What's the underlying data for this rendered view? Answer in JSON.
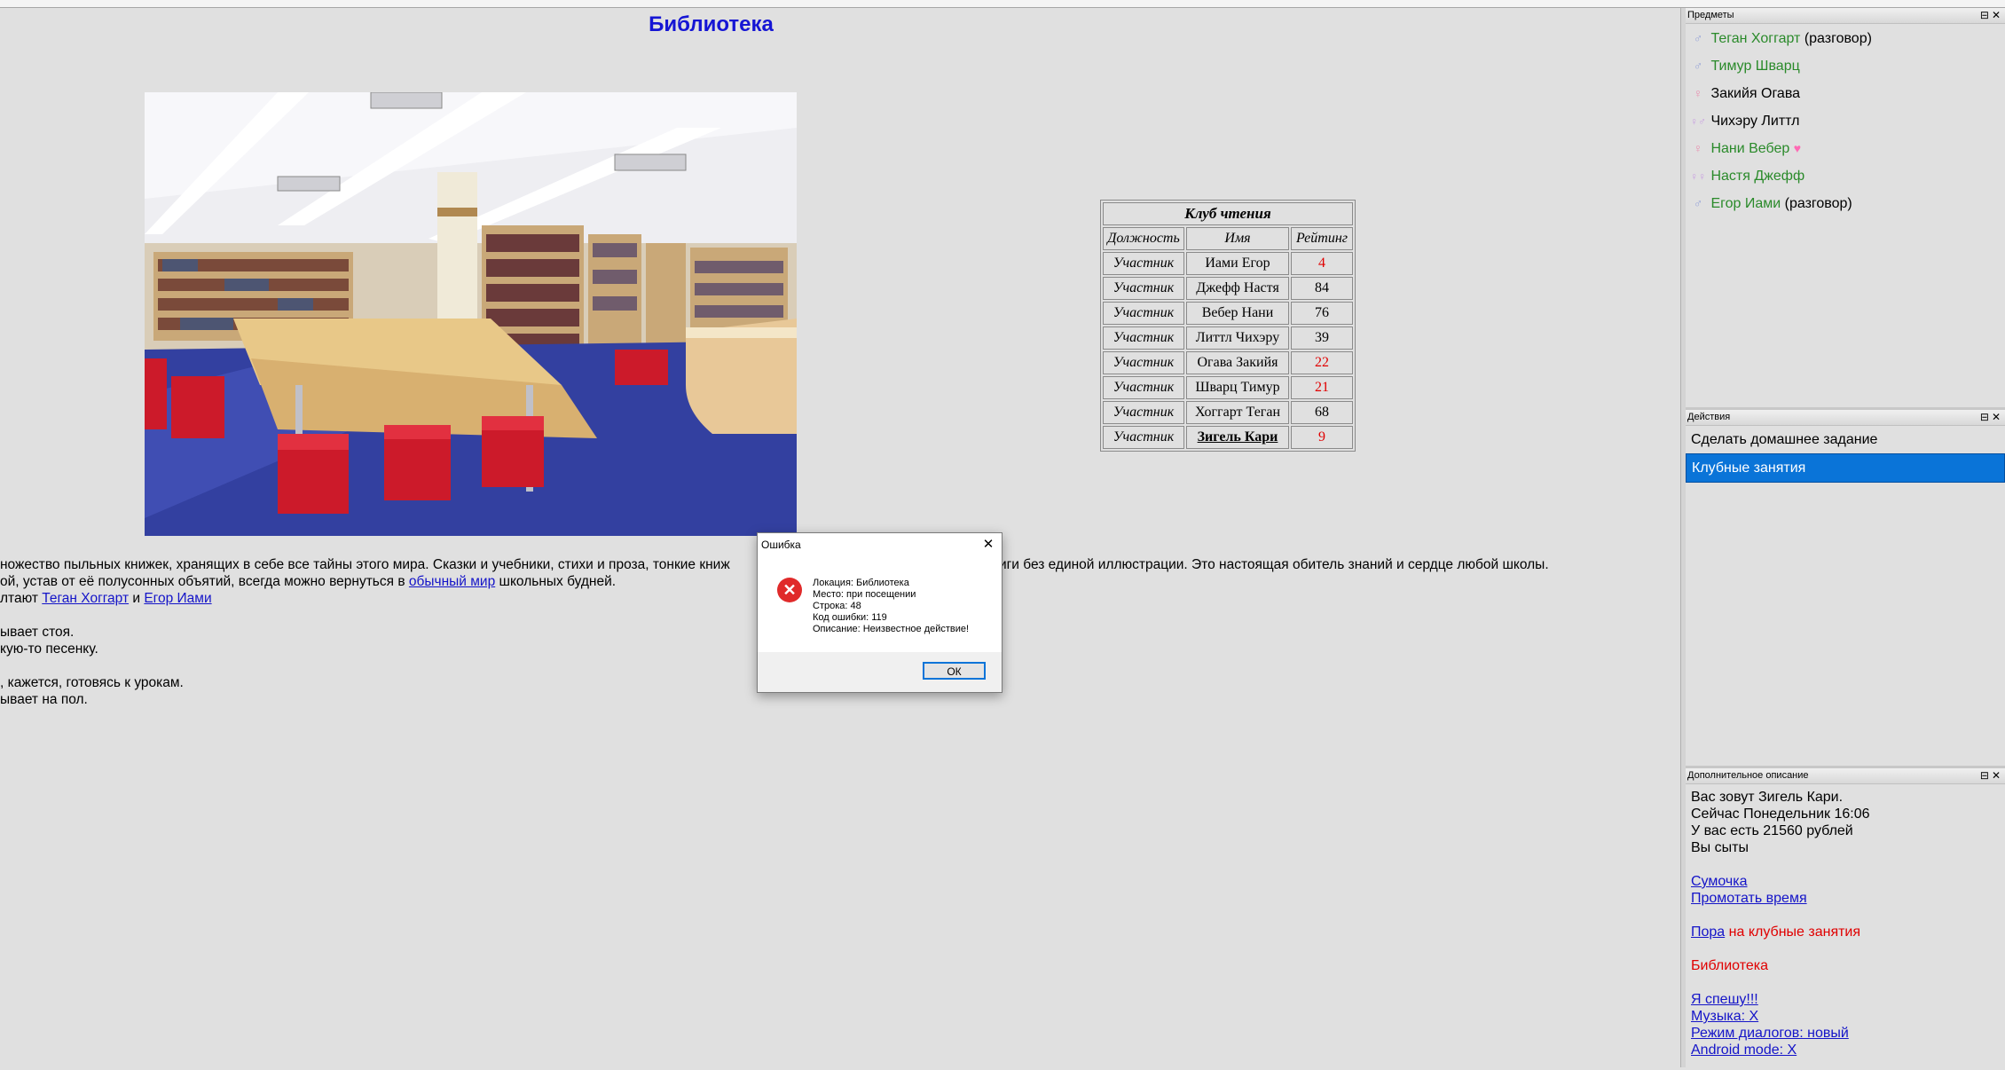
{
  "location_title": "Библиотека",
  "story": {
    "line1": "ножество пыльных книжек, хранящих в себе все тайны этого мира. Сказки и учебники, стихи и проза, тонкие книж",
    "line1_tail": "е книги без единой иллюстрации. Это настоящая обитель знаний и сердце любой школы.",
    "line2_pre": "ой, устав от её полусонных объятий, всегда можно вернуться в ",
    "line2_link": "обычный мир",
    "line2_post": " школьных будней.",
    "line3_pre": "лтают ",
    "line3_link1": "Теган Хоггарт",
    "line3_mid": " и ",
    "line3_link2": "Егор Иами",
    "line4": "ывает стоя.",
    "line5": "кую-то песенку.",
    "line6": ", кажется, готовясь к урокам.",
    "line7": "ывает на пол."
  },
  "club": {
    "caption": "Клуб чтения",
    "headers": [
      "Должность",
      "Имя",
      "Рейтинг"
    ],
    "rows": [
      {
        "role": "Участник",
        "name": "Иами Егор",
        "rating": "4"
      },
      {
        "role": "Участник",
        "name": "Джефф Настя",
        "rating": "84"
      },
      {
        "role": "Участник",
        "name": "Вебер Нани",
        "rating": "76"
      },
      {
        "role": "Участник",
        "name": "Литтл Чихэру",
        "rating": "39"
      },
      {
        "role": "Участник",
        "name": "Огава Закийя",
        "rating": "22"
      },
      {
        "role": "Участник",
        "name": "Шварц Тимур",
        "rating": "21"
      },
      {
        "role": "Участник",
        "name": "Хоггарт Теган",
        "rating": "68"
      },
      {
        "role": "Участник",
        "name": "Зигель Кари",
        "rating": "9"
      }
    ]
  },
  "panels": {
    "items_title": "Предметы",
    "actions_title": "Действия",
    "desc_title": "Дополнительное описание",
    "panel_buttons": "⊟✕"
  },
  "items": [
    {
      "name": "Теган Хоггарт",
      "suffix": " (разговор)",
      "symbol": "♂"
    },
    {
      "name": "Тимур Шварц",
      "suffix": "",
      "symbol": "♂"
    },
    {
      "name": "Закийя Огава",
      "suffix": "",
      "symbol": "♀"
    },
    {
      "name": "Чихэру Литтл",
      "suffix": "",
      "symbol": "♀♂"
    },
    {
      "name": "Нани Вебер",
      "suffix": "",
      "symbol": "♀",
      "heart": "♥"
    },
    {
      "name": "Настя Джефф",
      "suffix": "",
      "symbol": "♀♀"
    },
    {
      "name": "Егор Иами",
      "suffix": " (разговор)",
      "symbol": "♂"
    }
  ],
  "actions": [
    "Сделать домашнее задание",
    "Клубные занятия"
  ],
  "desc": {
    "line1": "Вас зовут Зигель Кари.",
    "line2": "Сейчас Понедельник 16:06",
    "line3": "У вас есть 21560 рублей",
    "line4": "Вы сыты",
    "bag": "Сумочка",
    "skip_time": "Промотать время",
    "time_link": "Пора",
    "time_text": " на клубные занятия",
    "location": "Библиотека",
    "hurry": "Я спешу!!!",
    "music": "Музыка: X",
    "dialog_mode": "Режим диалогов: новый",
    "android": "Android mode: X"
  },
  "dialog": {
    "title": "Ошибка",
    "close_glyph": "✕",
    "icon_glyph": "✕",
    "line1": "Локация: Библиотека",
    "line2": "Место: при посещении",
    "line3": "Строка: 48",
    "line4": "Код ошибки: 119",
    "line5": "Описание: Неизвестное действие!",
    "ok": "ОК"
  },
  "colors": {
    "title_blue": "#1515d4",
    "link_blue": "#1414c8",
    "rating_red": "#e00000",
    "selection_blue": "#0a74d8",
    "name_green": "#2a8a2a"
  }
}
